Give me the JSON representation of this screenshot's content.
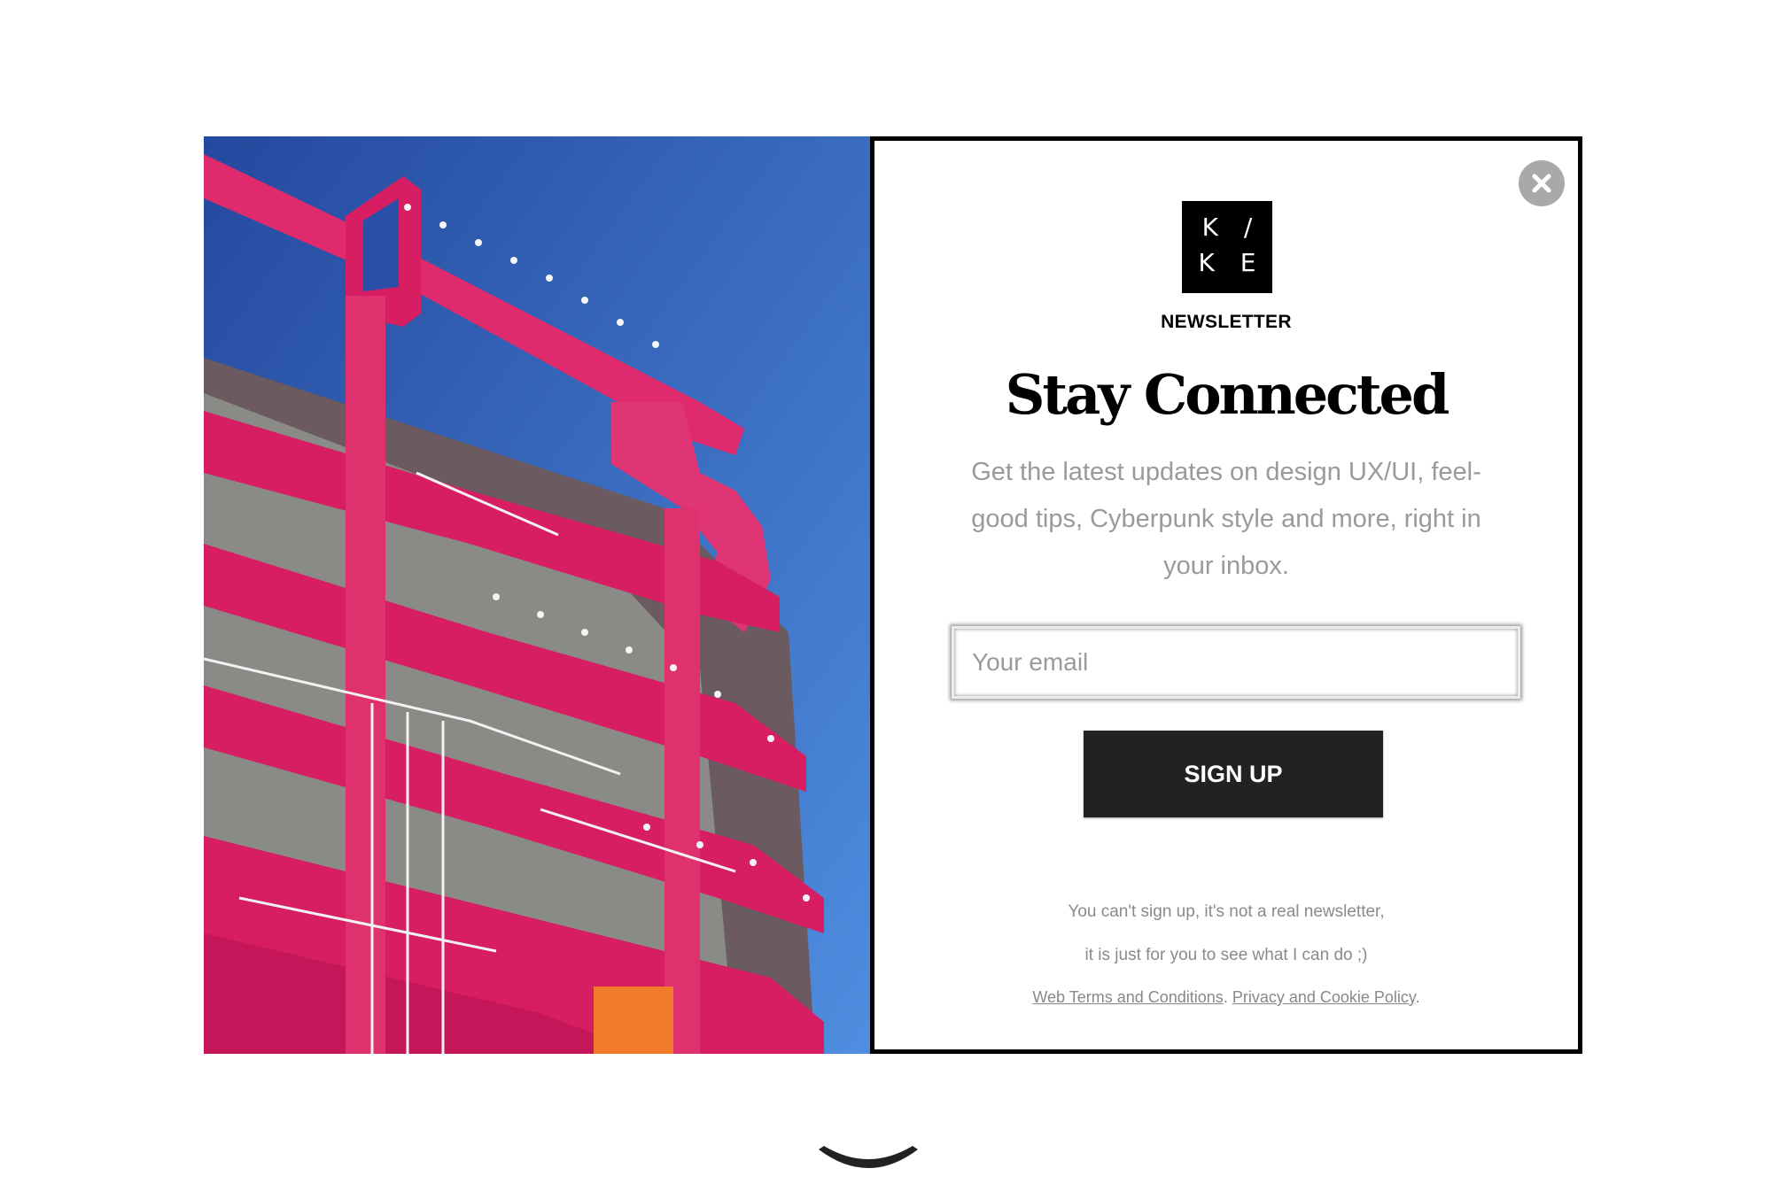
{
  "modal": {
    "close_icon": "close-icon",
    "logo": {
      "line1": "K /",
      "line2": "K E"
    },
    "label": "NEWSLETTER",
    "heading": "Stay Connected",
    "description": "Get the latest updates on design UX/UI, feel-good tips, Cyberpunk style and more, right in your inbox.",
    "email": {
      "placeholder": "Your email",
      "value": ""
    },
    "signup_label": "SIGN UP",
    "note_line1": "You can't sign up, it's not a real newsletter,",
    "note_line2": "it is just for you to see what I can do ;)",
    "terms_link": "Web Terms and Conditions",
    "privacy_link": "Privacy and Cookie Policy",
    "separator": ".",
    "terminator": "."
  },
  "photo": {
    "subject": "pink steel building under construction against blue sky"
  },
  "scroll": {
    "icon": "chevron-down-icon"
  },
  "colors": {
    "sky": "#2f5fb8",
    "structure": "#d81e63",
    "button": "#222222",
    "close_button": "#a9a9a9",
    "text_muted": "#9a9a9a"
  }
}
